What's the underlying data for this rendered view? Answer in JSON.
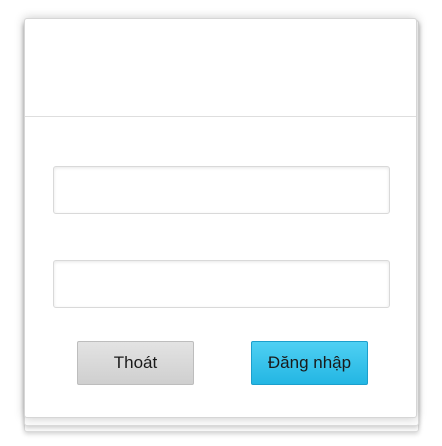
{
  "login_form": {
    "username": {
      "value": "",
      "placeholder": ""
    },
    "password": {
      "value": "",
      "placeholder": ""
    },
    "exit_label": "Thoát",
    "login_label": "Đăng nhập"
  },
  "colors": {
    "login_button": "#2ec0ea",
    "exit_button": "#d8d8d8"
  }
}
